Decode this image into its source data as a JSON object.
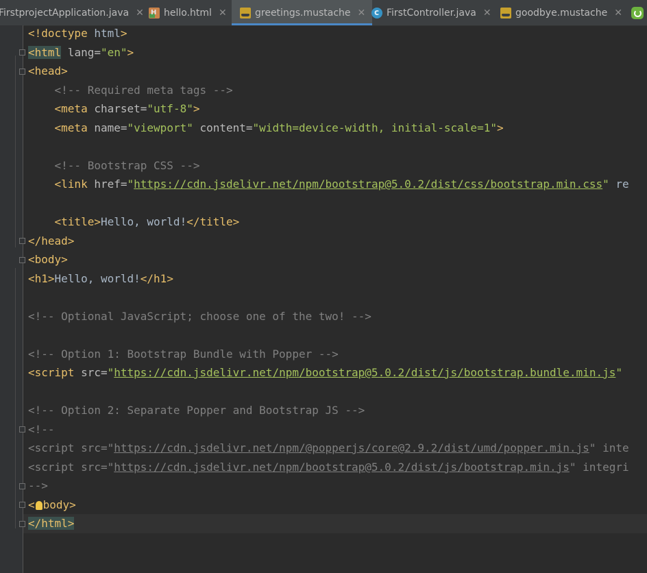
{
  "tabs": [
    {
      "label": "FirstprojectApplication.java",
      "icon": "java-file-icon",
      "active": false
    },
    {
      "label": "hello.html",
      "icon": "html-file-icon",
      "active": false
    },
    {
      "label": "greetings.mustache",
      "icon": "mustache-file-icon",
      "active": true
    },
    {
      "label": "FirstController.java",
      "icon": "class-file-icon",
      "active": false
    },
    {
      "label": "goodbye.mustache",
      "icon": "mustache-file-icon",
      "active": false
    }
  ],
  "close_glyph": "✕",
  "code_lines": [
    "<!doctype html>",
    "<html lang=\"en\">",
    "<head>",
    "    <!-- Required meta tags -->",
    "    <meta charset=\"utf-8\">",
    "    <meta name=\"viewport\" content=\"width=device-width, initial-scale=1\">",
    "",
    "    <!-- Bootstrap CSS -->",
    "    <link href=\"https://cdn.jsdelivr.net/npm/bootstrap@5.0.2/dist/css/bootstrap.min.css\" re",
    "",
    "    <title>Hello, world!</title>",
    "</head>",
    "<body>",
    "<h1>Hello, world!</h1>",
    "",
    "<!-- Optional JavaScript; choose one of the two! -->",
    "",
    "<!-- Option 1: Bootstrap Bundle with Popper -->",
    "<script src=\"https://cdn.jsdelivr.net/npm/bootstrap@5.0.2/dist/js/bootstrap.bundle.min.js\"",
    "",
    "<!-- Option 2: Separate Popper and Bootstrap JS -->",
    "<!--",
    "<script src=\"https://cdn.jsdelivr.net/npm/@popperjs/core@2.9.2/dist/umd/popper.min.js\" inte",
    "<script src=\"https://cdn.jsdelivr.net/npm/bootstrap@5.0.2/dist/js/bootstrap.min.js\" integri",
    "-->",
    "</body>",
    "</html>"
  ],
  "colors": {
    "tag": "#e8bf6a",
    "attribute": "#bababa",
    "string": "#a5c25c",
    "comment": "#808080",
    "text": "#a9b7c6",
    "background": "#2b2b2b",
    "tabbar": "#3c3f41",
    "active_tab_underline": "#4a88c7"
  }
}
